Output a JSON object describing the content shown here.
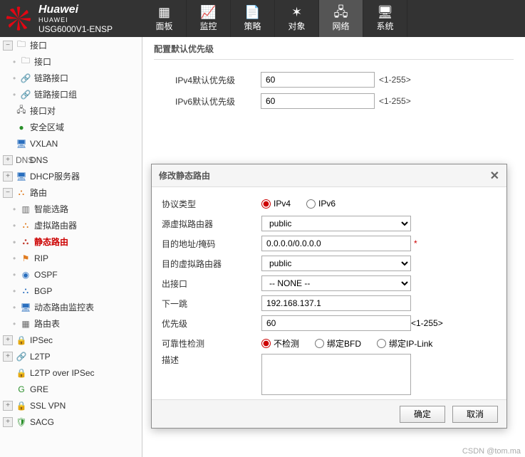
{
  "header": {
    "brand": "Huawei",
    "brand_sub": "HUAWEI",
    "device": "USG6000V1-ENSP",
    "nav": [
      {
        "label": "面板",
        "icon": "▦"
      },
      {
        "label": "监控",
        "icon": "📈"
      },
      {
        "label": "策略",
        "icon": "📄"
      },
      {
        "label": "对象",
        "icon": "✶"
      },
      {
        "label": "网络",
        "icon": "🖧",
        "active": true
      },
      {
        "label": "系统",
        "icon": "🖥"
      }
    ]
  },
  "sidebar": [
    {
      "label": "接口",
      "icon": "🗀",
      "exp": "−",
      "lvl": 0
    },
    {
      "label": "接口",
      "icon": "🗀",
      "lvl": 1
    },
    {
      "label": "链路接口",
      "icon": "🔗",
      "lvl": 1
    },
    {
      "label": "链路接口组",
      "icon": "🔗",
      "lvl": 1
    },
    {
      "label": "接口对",
      "icon": "🖧",
      "lvl": 0,
      "pad": true
    },
    {
      "label": "安全区域",
      "icon": "●",
      "lvl": 0,
      "pad": true,
      "cls": "ic-green"
    },
    {
      "label": "VXLAN",
      "icon": "🖥",
      "lvl": 0,
      "pad": true,
      "cls": "ic-blue"
    },
    {
      "label": "DNS",
      "icon": "DNS",
      "exp": "+",
      "lvl": 0
    },
    {
      "label": "DHCP服务器",
      "icon": "🖥",
      "exp": "+",
      "lvl": 0,
      "cls": "ic-blue"
    },
    {
      "label": "路由",
      "icon": "⛬",
      "exp": "−",
      "lvl": 0,
      "cls": "ic-orange"
    },
    {
      "label": "智能选路",
      "icon": "▥",
      "lvl": 1
    },
    {
      "label": "虚拟路由器",
      "icon": "⛬",
      "lvl": 1,
      "cls": "ic-orange"
    },
    {
      "label": "静态路由",
      "icon": "⛬",
      "lvl": 1,
      "active": true,
      "cls": "ic-red"
    },
    {
      "label": "RIP",
      "icon": "⚑",
      "lvl": 1,
      "cls": "ic-orange"
    },
    {
      "label": "OSPF",
      "icon": "◉",
      "lvl": 1,
      "cls": "ic-blue"
    },
    {
      "label": "BGP",
      "icon": "⛬",
      "lvl": 1,
      "cls": "ic-blue"
    },
    {
      "label": "动态路由监控表",
      "icon": "🖥",
      "lvl": 1,
      "cls": "ic-blue"
    },
    {
      "label": "路由表",
      "icon": "▦",
      "lvl": 1
    },
    {
      "label": "IPSec",
      "icon": "🔒",
      "exp": "+",
      "lvl": 0,
      "cls": "ic-orange"
    },
    {
      "label": "L2TP",
      "icon": "🔗",
      "exp": "+",
      "lvl": 0,
      "cls": "ic-blue"
    },
    {
      "label": "L2TP over IPSec",
      "icon": "🔒",
      "lvl": 0,
      "pad": true,
      "cls": "ic-orange"
    },
    {
      "label": "GRE",
      "icon": "G",
      "lvl": 0,
      "pad": true,
      "cls": "ic-green"
    },
    {
      "label": "SSL VPN",
      "icon": "🔒",
      "exp": "+",
      "lvl": 0,
      "cls": "ic-blue"
    },
    {
      "label": "SACG",
      "icon": "🛡",
      "exp": "+",
      "lvl": 0,
      "cls": "ic-green"
    }
  ],
  "panel": {
    "title": "配置默认优先级",
    "rows": [
      {
        "label": "IPv4默认优先级",
        "value": "60",
        "hint": "<1-255>"
      },
      {
        "label": "IPv6默认优先级",
        "value": "60",
        "hint": "<1-255>"
      }
    ]
  },
  "modal": {
    "title": "修改静态路由",
    "protocol_label": "协议类型",
    "protocol_options": {
      "ipv4": "IPv4",
      "ipv6": "IPv6"
    },
    "src_vr_label": "源虚拟路由器",
    "src_vr_value": "public",
    "dest_label": "目的地址/掩码",
    "dest_value": "0.0.0.0/0.0.0.0",
    "dst_vr_label": "目的虚拟路由器",
    "dst_vr_value": "public",
    "outif_label": "出接口",
    "outif_value": "-- NONE --",
    "nexthop_label": "下一跳",
    "nexthop_value": "192.168.137.1",
    "prio_label": "优先级",
    "prio_value": "60",
    "prio_hint": "<1-255>",
    "reliab_label": "可靠性检测",
    "reliab_options": {
      "none": "不检测",
      "bfd": "绑定BFD",
      "iplink": "绑定IP-Link"
    },
    "desc_label": "描述",
    "desc_value": "",
    "ok": "确定",
    "cancel": "取消"
  },
  "watermark": "CSDN @tom.ma"
}
